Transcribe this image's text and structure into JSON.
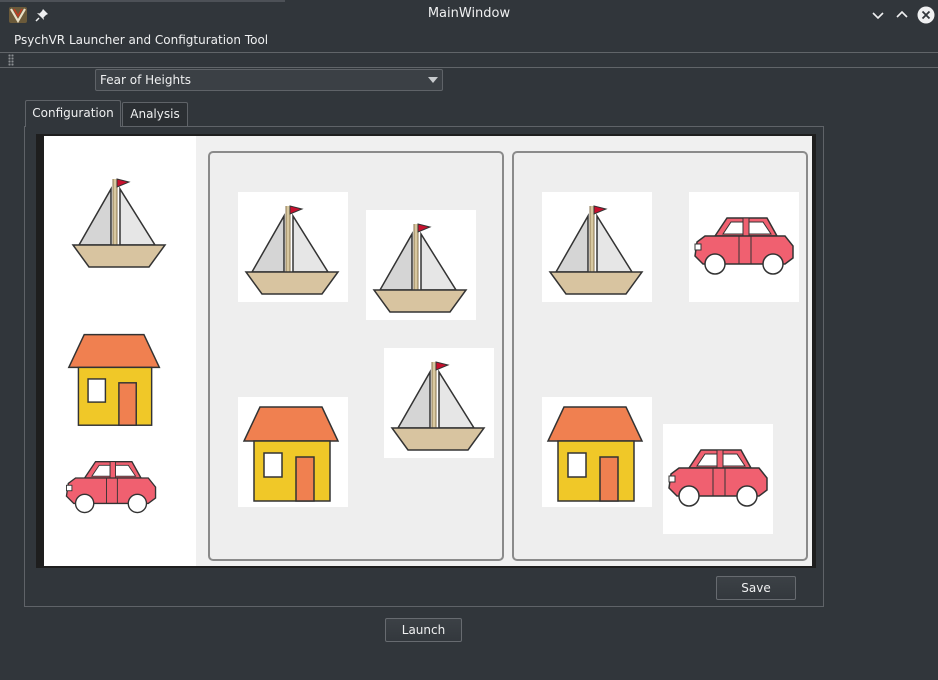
{
  "window": {
    "title": "MainWindow"
  },
  "menu": {
    "items": [
      "PsychVR Launcher and Configturation Tool"
    ]
  },
  "scenario_select": {
    "selected": "Fear of Heights"
  },
  "tabs": [
    {
      "label": "Configuration",
      "active": true
    },
    {
      "label": "Analysis",
      "active": false
    }
  ],
  "palette": {
    "items": [
      "boat",
      "house",
      "car"
    ]
  },
  "groups": [
    {
      "items": [
        "boat",
        "boat",
        "house",
        "boat"
      ]
    },
    {
      "items": [
        "boat",
        "car",
        "house",
        "car"
      ]
    }
  ],
  "buttons": {
    "save": "Save",
    "launch": "Launch"
  },
  "colors": {
    "window_bg": "#31363b",
    "canvas_bg": "#ffffff",
    "group_bg": "#eeeeee",
    "house_roof": "#f08050",
    "house_wall": "#f0c828",
    "car_body": "#f06070",
    "boat_hull": "#d8c4a0"
  }
}
